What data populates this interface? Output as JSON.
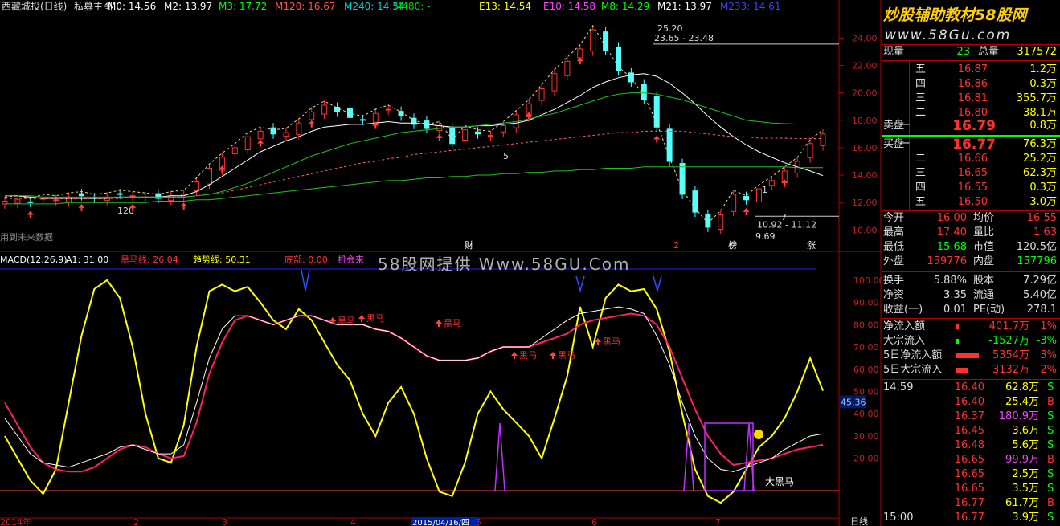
{
  "title_bar": {
    "stock_name": "西藏城投(日线)",
    "indicator_name": "私募主图",
    "ma_items": [
      {
        "label": "M0: 14.56",
        "color": "#ffffff"
      },
      {
        "label": "M2: 13.97",
        "color": "#ffffff"
      },
      {
        "label": "M3: 17.72",
        "color": "#00ff00"
      },
      {
        "label": "M120: 16.67",
        "color": "#ff5050"
      },
      {
        "label": "M240: 14.54",
        "color": "#00d0d0"
      },
      {
        "label": "M480: -",
        "color": "#00d000"
      },
      {
        "label": "E13: 14.54",
        "color": "#ffff00"
      },
      {
        "label": "E10: 14.58",
        "color": "#ff40ff"
      },
      {
        "label": "M8: 14.29",
        "color": "#00ff00"
      },
      {
        "label": "M21: 13.97",
        "color": "#ffffff"
      },
      {
        "label": "M233: 14.61",
        "color": "#4040ff"
      }
    ]
  },
  "brand": {
    "logo_text": "炒股辅助教材58股网",
    "url_text": "www.58Gu.com"
  },
  "watermark": "58股网提供 Www.58GU.Com",
  "future_data_note": "用到未来数据",
  "macd_bar": {
    "items": [
      {
        "label": "MACD(12,26,9)",
        "color": "#ffffff"
      },
      {
        "label": "A1: 31.00",
        "color": "#ffffff"
      },
      {
        "label": "黑马线: 26.04",
        "color": "#ff3030"
      },
      {
        "label": "趋势线: 50.31",
        "color": "#ffff00"
      },
      {
        "label": "底部: 0.00",
        "color": "#ff3030"
      },
      {
        "label": "机会来",
        "color": "#ff40ff"
      }
    ]
  },
  "chart_data": [
    {
      "type": "candlestick",
      "title": "西藏城投(日线)",
      "y_ticks": [
        "24.00",
        "22.00",
        "20.00",
        "18.00",
        "16.00",
        "14.00",
        "12.00",
        "10.00"
      ],
      "ylim": [
        9.2,
        25.6
      ],
      "x_ticks": [
        "2014年",
        "2",
        "3",
        "4",
        "2015/04/16/四",
        "5",
        "6",
        "7"
      ],
      "annotations": [
        "25.20",
        "23.65 - 23.48",
        "10.92 - 11.12",
        "9.69",
        "120",
        "5",
        "1",
        "7",
        "财",
        "2",
        "榜",
        "涨"
      ],
      "series": [
        {
          "name": "M0",
          "values": [
            12.1,
            12.2,
            12.0,
            12.3,
            12.2,
            12.4,
            12.5,
            12.3,
            12.4,
            12.6,
            12.5,
            12.4,
            12.3,
            12.5,
            12.6,
            13.5,
            14.5,
            15.3,
            16.0,
            16.8,
            17.2,
            17.0,
            17.1,
            17.8,
            18.6,
            19.1,
            18.6,
            18.2,
            18.0,
            18.5,
            18.8,
            18.3,
            17.7,
            17.4,
            17.6,
            16.3,
            17.3,
            17.0,
            16.9,
            17.6,
            18.4,
            19.2,
            20.3,
            21.4,
            22.3,
            23.2,
            24.6,
            23.1,
            21.6,
            20.8,
            19.5,
            17.5,
            15.0,
            12.6,
            11.3,
            10.2,
            11.1,
            12.6,
            12.2,
            13.0,
            13.6,
            14.3,
            15.0,
            16.3,
            17.0
          ]
        },
        {
          "name": "M21",
          "values": [
            12.5,
            12.5,
            12.4,
            12.3,
            12.3,
            12.3,
            12.3,
            12.3,
            12.3,
            12.4,
            12.4,
            12.4,
            12.4,
            12.5,
            12.5,
            12.8,
            13.3,
            13.9,
            14.5,
            15.1,
            15.7,
            16.1,
            16.5,
            16.8,
            17.2,
            17.5,
            17.6,
            17.7,
            17.7,
            17.8,
            17.9,
            17.8,
            17.8,
            17.7,
            17.6,
            17.5,
            17.5,
            17.6,
            17.6,
            17.7,
            17.8,
            18.0,
            18.4,
            18.8,
            19.3,
            19.8,
            20.4,
            20.8,
            21.1,
            21.3,
            21.4,
            21.2,
            20.7,
            20.0,
            19.2,
            18.3,
            17.5,
            16.8,
            16.2,
            15.7,
            15.3,
            14.9,
            14.6,
            14.3,
            13.97
          ]
        },
        {
          "name": "M120",
          "values": [
            12.3,
            12.3,
            12.3,
            12.3,
            12.3,
            12.3,
            12.3,
            12.3,
            12.3,
            12.3,
            12.4,
            12.4,
            12.4,
            12.4,
            12.4,
            12.5,
            12.6,
            12.7,
            12.9,
            13.1,
            13.3,
            13.5,
            13.7,
            13.9,
            14.1,
            14.3,
            14.5,
            14.7,
            14.9,
            15.0,
            15.2,
            15.3,
            15.5,
            15.6,
            15.7,
            15.8,
            15.9,
            16.0,
            16.1,
            16.2,
            16.3,
            16.4,
            16.5,
            16.6,
            16.7,
            16.8,
            16.9,
            17.0,
            17.1,
            17.1,
            17.2,
            17.2,
            17.2,
            17.2,
            17.1,
            17.0,
            16.9,
            16.8,
            16.8,
            16.7,
            16.7,
            16.7,
            16.67,
            16.67,
            16.67
          ]
        },
        {
          "name": "M240",
          "values": [
            11.9,
            11.9,
            11.9,
            11.9,
            11.9,
            12.0,
            12.0,
            12.0,
            12.0,
            12.0,
            12.0,
            12.0,
            12.1,
            12.1,
            12.1,
            12.2,
            12.2,
            12.3,
            12.4,
            12.5,
            12.6,
            12.7,
            12.8,
            12.9,
            13.0,
            13.1,
            13.2,
            13.3,
            13.4,
            13.5,
            13.6,
            13.6,
            13.7,
            13.8,
            13.8,
            13.9,
            13.9,
            14.0,
            14.0,
            14.1,
            14.1,
            14.2,
            14.2,
            14.3,
            14.3,
            14.4,
            14.4,
            14.5,
            14.5,
            14.5,
            14.6,
            14.6,
            14.6,
            14.6,
            14.6,
            14.6,
            14.6,
            14.6,
            14.6,
            14.6,
            14.6,
            14.6,
            14.55,
            14.54,
            14.54
          ]
        },
        {
          "name": "M3",
          "values": [
            12.5,
            12.5,
            12.5,
            12.4,
            12.4,
            12.4,
            12.4,
            12.4,
            12.4,
            12.4,
            12.4,
            12.4,
            12.4,
            12.4,
            12.4,
            12.5,
            12.6,
            12.8,
            13.1,
            13.4,
            13.8,
            14.2,
            14.6,
            15.0,
            15.4,
            15.7,
            16.0,
            16.3,
            16.5,
            16.7,
            16.9,
            17.1,
            17.2,
            17.3,
            17.4,
            17.5,
            17.5,
            17.6,
            17.7,
            17.8,
            17.9,
            18.1,
            18.3,
            18.5,
            18.8,
            19.1,
            19.4,
            19.7,
            19.9,
            20.0,
            20.0,
            19.9,
            19.7,
            19.5,
            19.2,
            18.9,
            18.6,
            18.3,
            18.0,
            17.9,
            17.8,
            17.75,
            17.72,
            17.72,
            17.72
          ]
        }
      ]
    },
    {
      "type": "line",
      "title": "MACD(12,26,9)",
      "y_ticks": [
        "100.00",
        "90.00",
        "80.00",
        "70.00",
        "60.00",
        "50.00",
        "40.00",
        "30.00",
        "20.00"
      ],
      "ylim": [
        -5,
        105
      ],
      "current_value_label": "45.36",
      "annotations": [
        "黑马",
        "黑马",
        "黑马",
        "黑马",
        "黑马",
        "黑马",
        "大黑马"
      ],
      "series": [
        {
          "name": "趋势线",
          "values": [
            30,
            20,
            10,
            4,
            15,
            45,
            75,
            96,
            100,
            92,
            70,
            40,
            20,
            18,
            35,
            70,
            95,
            98,
            95,
            97,
            90,
            82,
            78,
            87,
            82,
            72,
            62,
            55,
            40,
            30,
            45,
            52,
            40,
            20,
            5,
            3,
            18,
            40,
            50,
            42,
            36,
            30,
            20,
            38,
            57,
            88,
            70,
            92,
            98,
            95,
            96,
            87,
            68,
            40,
            15,
            3,
            0,
            5,
            15,
            25,
            30,
            38,
            50,
            65,
            50.31
          ]
        },
        {
          "name": "黑马线",
          "values": [
            45,
            35,
            25,
            18,
            15,
            14,
            14,
            16,
            20,
            24,
            26,
            25,
            22,
            20,
            21,
            36,
            58,
            72,
            82,
            84,
            82,
            80,
            82,
            84,
            84,
            82,
            80,
            80,
            80,
            78,
            77,
            74,
            70,
            66,
            64,
            64,
            64,
            65,
            68,
            70,
            70,
            70,
            72,
            74,
            76,
            80,
            82,
            83,
            84,
            85,
            84,
            80,
            70,
            56,
            42,
            30,
            22,
            17,
            18,
            19,
            20,
            22,
            24,
            25,
            26.04
          ]
        },
        {
          "name": "A1",
          "values": [
            38,
            30,
            22,
            18,
            17,
            16,
            18,
            20,
            22,
            25,
            26,
            24,
            22,
            22,
            26,
            45,
            65,
            78,
            84,
            84,
            82,
            80,
            82,
            84,
            84,
            82,
            80,
            80,
            80,
            78,
            77,
            74,
            70,
            66,
            64,
            64,
            64,
            65,
            68,
            70,
            70,
            70,
            74,
            78,
            82,
            85,
            86,
            87,
            88,
            87,
            85,
            75,
            62,
            45,
            30,
            20,
            15,
            14,
            16,
            18,
            20,
            24,
            27,
            30,
            31
          ]
        }
      ]
    }
  ],
  "quote": {
    "xianliang_label": "现量",
    "xianliang": "23",
    "zongliang_label": "总量",
    "zongliang": "317572",
    "sell_label": "卖盘",
    "buy_label": "买盘",
    "asks": [
      {
        "level": "五",
        "price": "16.87",
        "vol": "1.2万"
      },
      {
        "level": "四",
        "price": "16.86",
        "vol": "0.3万"
      },
      {
        "level": "三",
        "price": "16.81",
        "vol": "355.7万"
      },
      {
        "level": "二",
        "price": "16.80",
        "vol": "38.1万"
      },
      {
        "level": "一",
        "price": "16.79",
        "vol": "0.8万"
      }
    ],
    "bids": [
      {
        "level": "一",
        "price": "16.77",
        "vol": "76.3万"
      },
      {
        "level": "二",
        "price": "16.66",
        "vol": "25.2万"
      },
      {
        "level": "三",
        "price": "16.65",
        "vol": "62.3万"
      },
      {
        "level": "四",
        "price": "16.55",
        "vol": "0.3万"
      },
      {
        "level": "五",
        "price": "16.50",
        "vol": "3.0万"
      }
    ],
    "stats": [
      {
        "l1": "今开",
        "v1": "16.00",
        "l2": "均价",
        "v2": "16.55"
      },
      {
        "l1": "最高",
        "v1": "17.40",
        "l2": "量比",
        "v2": "1.63"
      },
      {
        "l1": "最低",
        "v1": "15.68",
        "l2": "市值",
        "v2": "120.5亿"
      },
      {
        "l1": "外盘",
        "v1": "159776",
        "l2": "内盘",
        "v2": "157796"
      }
    ],
    "stats2": [
      {
        "l1": "换手",
        "v1": "5.88%",
        "l2": "股本",
        "v2": "7.29亿"
      },
      {
        "l1": "净资",
        "v1": "3.35",
        "l2": "流通",
        "v2": "5.40亿"
      },
      {
        "l1": "收益(一)",
        "v1": "0.01",
        "l2": "PE(动)",
        "v2": "278.1"
      }
    ],
    "flows": [
      {
        "label": "净流入额",
        "value": "401.7万",
        "pct": "1%",
        "color": "#ff3030",
        "bar": 0.05
      },
      {
        "label": "大宗流入",
        "value": "-1527万",
        "pct": "-3%",
        "color": "#00ff00",
        "bar": 0.08
      },
      {
        "label": "5日净流入额",
        "value": "5354万",
        "pct": "3%",
        "color": "#ff3030",
        "bar": 0.9
      },
      {
        "label": "5日大宗流入",
        "value": "3132万",
        "pct": "2%",
        "color": "#ff3030",
        "bar": 0.5
      }
    ],
    "ticks": [
      {
        "time": "14:59",
        "price": "16.40",
        "vol": "62.8万",
        "side": "S"
      },
      {
        "time": "",
        "price": "16.40",
        "vol": "25.4万",
        "side": "B"
      },
      {
        "time": "",
        "price": "16.37",
        "vol": "180.9万",
        "side": "S"
      },
      {
        "time": "",
        "price": "16.45",
        "vol": "3.6万",
        "side": "S"
      },
      {
        "time": "",
        "price": "16.48",
        "vol": "5.6万",
        "side": "S"
      },
      {
        "time": "",
        "price": "16.65",
        "vol": "99.9万",
        "side": "B"
      },
      {
        "time": "",
        "price": "16.65",
        "vol": "2.5万",
        "side": "S"
      },
      {
        "time": "",
        "price": "16.65",
        "vol": "3.5万",
        "side": "S"
      },
      {
        "time": "",
        "price": "16.77",
        "vol": "61.7万",
        "side": "B"
      },
      {
        "time": "15:00",
        "price": "16.77",
        "vol": "3.9万",
        "side": "S"
      }
    ],
    "period_label": "日线"
  }
}
